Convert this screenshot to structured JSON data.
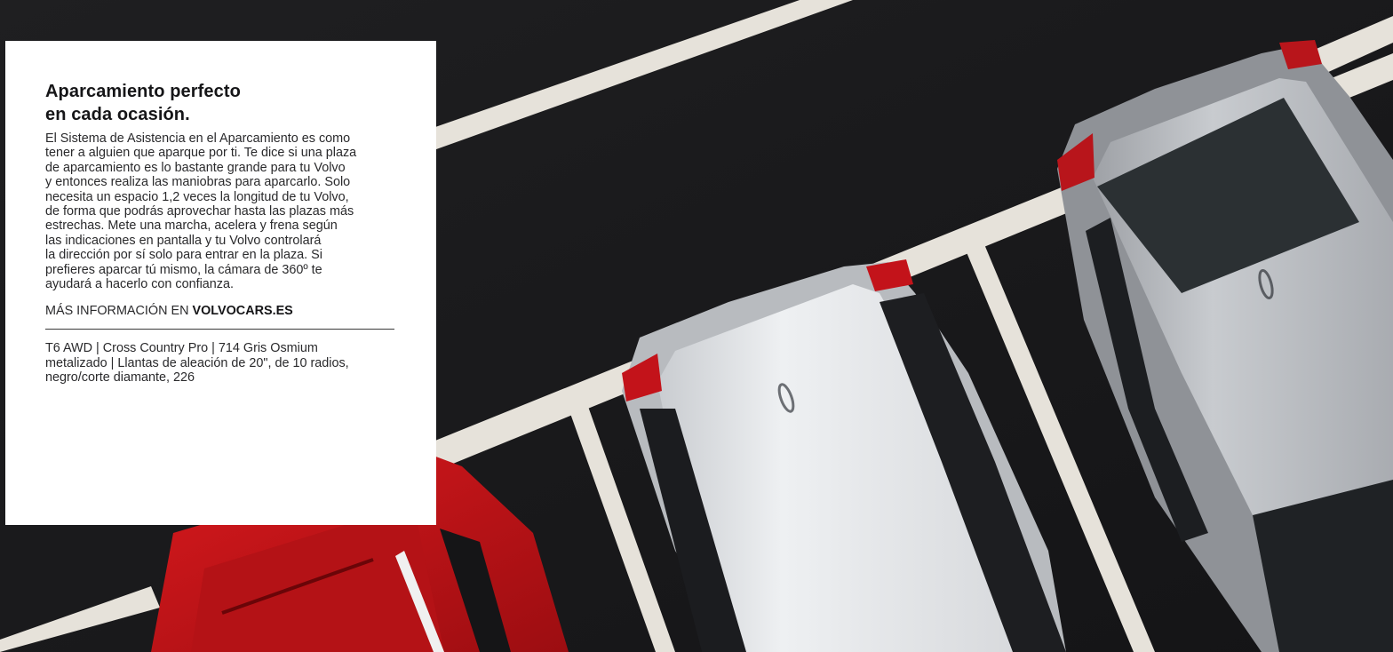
{
  "headline": {
    "line1": "Aparcamiento perfecto",
    "line2": "en cada ocasión."
  },
  "body_lines": [
    "El Sistema de Asistencia en el Aparcamiento es como",
    "tener a alguien que aparque por ti. Te dice si una plaza",
    "de aparcamiento es lo bastante grande para tu Volvo",
    "y entonces realiza las maniobras para aparcarlo. Solo",
    "necesita un espacio 1,2 veces la longitud de tu Volvo,",
    "de forma que podrás aprovechar hasta las plazas más",
    "estrechas. Mete una marcha, acelera y frena según",
    "las indicaciones en pantalla y tu Volvo controlará",
    "la dirección por sí solo para entrar en la plaza. Si",
    "prefieres aparcar tú mismo, la cámara de 360º te",
    "ayudará a hacerlo con confianza."
  ],
  "more_info": {
    "prefix": "MÁS INFORMACIÓN EN ",
    "site": "VOLVOCARS.ES"
  },
  "specs_lines": [
    "T6 AWD | Cross Country Pro | 714 Gris Osmium",
    "metalizado | Llantas de aleación de 20\", de 10 radios,",
    "negro/corte diamante, 226"
  ],
  "colors": {
    "asphalt": "#1c1c1e",
    "parking_line": "#e6e2da",
    "car_red": "#c41418",
    "car_white": "#e4e6e8",
    "car_silver": "#b9bcc0",
    "card": "#ffffff",
    "text": "#161618"
  },
  "icons": [
    "volvo-emblem-icon"
  ]
}
